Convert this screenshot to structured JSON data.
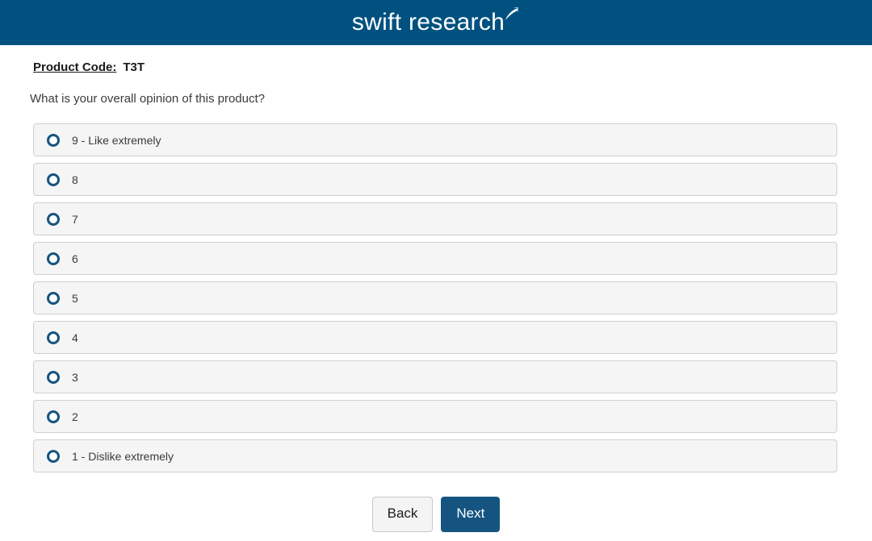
{
  "header": {
    "logo_text": "swift research",
    "logo_mark_name": "swoosh-arrow-icon",
    "background_color": "#005180"
  },
  "survey": {
    "product_code_label": "Product Code:",
    "product_code_value": "T3T",
    "question": "What is your overall opinion of this product?",
    "options": [
      {
        "value": "9",
        "label": "9 - Like extremely",
        "selected": false
      },
      {
        "value": "8",
        "label": "8",
        "selected": false
      },
      {
        "value": "7",
        "label": "7",
        "selected": false
      },
      {
        "value": "6",
        "label": "6",
        "selected": false
      },
      {
        "value": "5",
        "label": "5",
        "selected": false
      },
      {
        "value": "4",
        "label": "4",
        "selected": false
      },
      {
        "value": "3",
        "label": "3",
        "selected": false
      },
      {
        "value": "2",
        "label": "2",
        "selected": false
      },
      {
        "value": "1",
        "label": "1 - Dislike extremely",
        "selected": false
      }
    ]
  },
  "navigation": {
    "back_label": "Back",
    "next_label": "Next"
  },
  "colors": {
    "brand_blue": "#005180",
    "radio_blue": "#15557f",
    "next_button": "#155480",
    "row_background": "#f5f5f5",
    "row_border": "#cfcfcf"
  }
}
